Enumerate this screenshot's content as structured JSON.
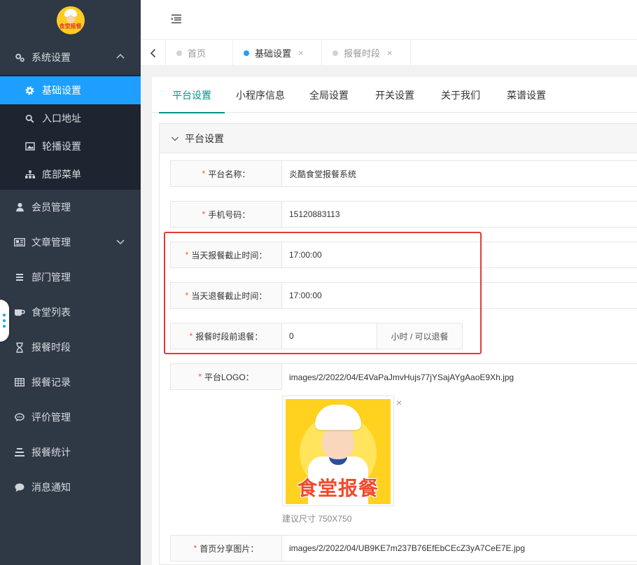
{
  "sidebar": {
    "logo_text": "食堂报餐",
    "menu": [
      {
        "label": "系统设置",
        "icon": "gears-icon"
      },
      {
        "label": "会员管理",
        "icon": "user-icon"
      },
      {
        "label": "文章管理",
        "icon": "newspaper-icon"
      },
      {
        "label": "部门管理",
        "icon": "list-icon"
      },
      {
        "label": "食堂列表",
        "icon": "coffee-icon"
      },
      {
        "label": "报餐时段",
        "icon": "hourglass-icon"
      },
      {
        "label": "报餐记录",
        "icon": "table-icon"
      },
      {
        "label": "评价管理",
        "icon": "comment-icon"
      },
      {
        "label": "报餐统计",
        "icon": "bars-icon"
      },
      {
        "label": "消息通知",
        "icon": "chat-icon"
      }
    ],
    "submenu": [
      {
        "label": "基础设置",
        "icon": "gear-icon"
      },
      {
        "label": "入口地址",
        "icon": "search-icon"
      },
      {
        "label": "轮播设置",
        "icon": "image-icon"
      },
      {
        "label": "底部菜单",
        "icon": "sitemap-icon"
      }
    ]
  },
  "tabs": [
    {
      "label": "首页"
    },
    {
      "label": "基础设置",
      "close": "×"
    },
    {
      "label": "报餐时段",
      "close": "×"
    }
  ],
  "content_tabs": [
    "平台设置",
    "小程序信息",
    "全局设置",
    "开关设置",
    "关于我们",
    "菜谱设置"
  ],
  "panel": {
    "title": "平台设置",
    "required_mark": "*",
    "fields": {
      "platform_name": {
        "label": "平台名称：",
        "value": "炎酷食堂报餐系统"
      },
      "phone": {
        "label": "手机号码：",
        "value": "15120883113"
      },
      "order_deadline": {
        "label": "当天报餐截止时间：",
        "value": "17:00:00"
      },
      "cancel_deadline": {
        "label": "当天退餐截止时间：",
        "value": "17:00:00"
      },
      "cancel_before": {
        "label": "报餐时段前退餐：",
        "value": "0",
        "suffix": "小时 / 可以退餐"
      },
      "logo": {
        "label": "平台LOGO：",
        "value": "images/2/2022/04/E4VaPaJmvHujs77jYSajAYgAaoE9Xh.jpg",
        "image_text": "食堂报餐",
        "remove": "×",
        "hint": "建议尺寸 750X750"
      },
      "share_image": {
        "label": "首页分享图片：",
        "value": "images/2/2022/04/UB9KE7m237B76EfEbCEcZ3yA7CeE7E.jpg"
      }
    }
  },
  "colors": {
    "sidebar_bg": "#2f3845",
    "active_blue": "#1e9fff",
    "tab_green": "#009688",
    "required_red": "#ff5722",
    "highlight_red": "#e53935"
  }
}
